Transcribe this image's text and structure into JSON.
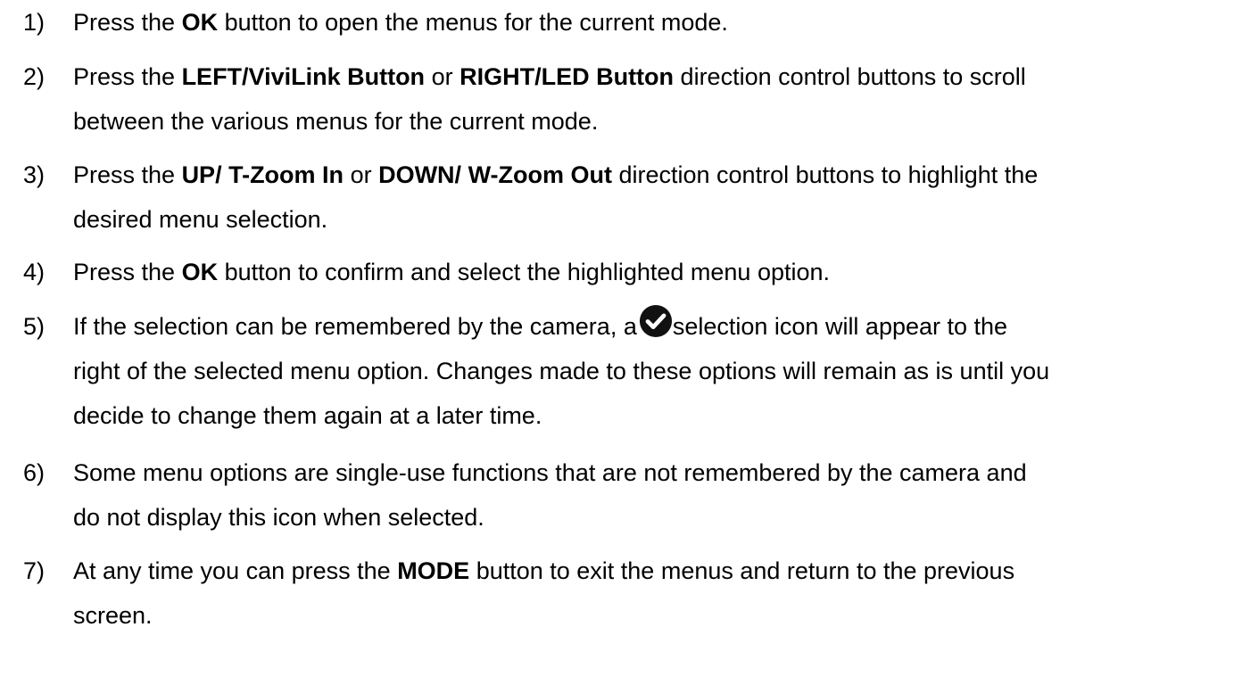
{
  "steps": [
    {
      "number": "1)",
      "lines": [
        {
          "a": "Press the ",
          "b1": "OK",
          "c": " button to open the menus for the current mode."
        }
      ]
    },
    {
      "number": "2)",
      "lines": [
        {
          "a": "Press the ",
          "b1": "LEFT/ViviLink Button",
          "c": " or ",
          "b2": "RIGHT/LED Button",
          "d": " direction control buttons to scroll"
        },
        {
          "a": "between the various menus for the current mode."
        }
      ]
    },
    {
      "number": "3)",
      "lines": [
        {
          "a": "Press the ",
          "b1": "UP/ T-Zoom In",
          "c": " or ",
          "b2": "DOWN/ W-Zoom Out",
          "d": " direction control buttons to highlight the"
        },
        {
          "a": "desired menu selection."
        }
      ]
    },
    {
      "number": "4)",
      "lines": [
        {
          "a": "Press the ",
          "b1": "OK",
          "c": " button to confirm and select the highlighted menu option."
        }
      ]
    },
    {
      "number": "5)",
      "lines": [
        {
          "a": "If the selection can be remembered by the camera, a",
          "icon": "check-circle-icon",
          "c": "selection icon will appear to the"
        },
        {
          "a": "right of the selected menu option. Changes made to these options will remain as is until you"
        },
        {
          "a": "decide to change them again at a later time."
        }
      ]
    },
    {
      "number": "6)",
      "lines": [
        {
          "a": "Some menu options are single-use functions that are not remembered by the camera and"
        },
        {
          "a": "do not display this icon when selected."
        }
      ]
    },
    {
      "number": "7)",
      "lines": [
        {
          "a": "At any time you can press the ",
          "b1": "MODE",
          "c": " button to exit the menus and return to the previous"
        },
        {
          "a": "screen."
        }
      ]
    }
  ]
}
